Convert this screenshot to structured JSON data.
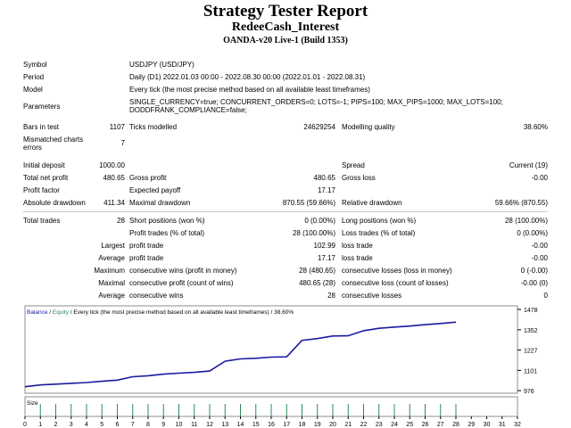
{
  "header": {
    "title": "Strategy Tester Report",
    "expert": "RedeeCash_Interest",
    "build": "OANDA-v20 Live-1 (Build 1353)"
  },
  "info": {
    "symbol_label": "Symbol",
    "symbol": "USDJPY (USD/JPY)",
    "period_label": "Period",
    "period": "Daily (D1) 2022.01.03 00:00 - 2022.08.30 00:00 (2022.01.01 - 2022.08.31)",
    "model_label": "Model",
    "model": "Every tick (the most precise method based on all available least timeframes)",
    "parameters_label": "Parameters",
    "parameters_1": "SINGLE_CURRENCY=true; CONCURRENT_ORDERS=0; LOTS=-1; PIPS=100; MAX_PIPS=1000; MAX_LOTS=100;",
    "parameters_2": "DODDFRANK_COMPLIANCE=false;"
  },
  "stats": {
    "bars_label": "Bars in test",
    "bars": "1107",
    "ticks_label": "Ticks modelled",
    "ticks": "24629254",
    "quality_label": "Modelling quality",
    "quality": "38.60%",
    "mismatched_label_1": "Mismatched charts",
    "mismatched_label_2": "errors",
    "mismatched": "7",
    "deposit_label": "Initial deposit",
    "deposit": "1000.00",
    "spread_label": "Spread",
    "spread": "Current (19)",
    "net_profit_label": "Total net profit",
    "net_profit": "480.65",
    "gross_profit_label": "Gross profit",
    "gross_profit": "480.65",
    "gross_loss_label": "Gross loss",
    "gross_loss": "-0.00",
    "profit_factor_label": "Profit factor",
    "payoff_label": "Expected payoff",
    "payoff": "17.17",
    "abs_dd_label": "Absolute drawdown",
    "abs_dd": "411.34",
    "max_dd_label": "Maximal drawdown",
    "max_dd": "870.55 (59.66%)",
    "rel_dd_label": "Relative drawdown",
    "rel_dd": "59.66% (870.55)",
    "total_trades_label": "Total trades",
    "total_trades": "28",
    "short_label": "Short positions (won %)",
    "short": "0 (0.00%)",
    "long_label": "Long positions (won %)",
    "long": "28 (100.00%)",
    "profit_trades_label": "Profit trades (% of total)",
    "profit_trades": "28 (100.00%)",
    "loss_trades_label": "Loss trades (% of total)",
    "loss_trades": "0 (0.00%)",
    "largest_label": "Largest",
    "largest_profit_label": "profit trade",
    "largest_profit": "102.99",
    "largest_loss_label": "loss trade",
    "largest_loss": "-0.00",
    "average_label": "Average",
    "avg_profit_label": "profit trade",
    "avg_profit": "17.17",
    "avg_loss_label": "loss trade",
    "avg_loss": "-0.00",
    "maximum_label": "Maximum",
    "max_wins_money_label": "consecutive wins (profit in money)",
    "max_wins_money": "28 (480.65)",
    "max_losses_money_label": "consecutive losses (loss in money)",
    "max_losses_money": "0 (-0.00)",
    "maximal_label": "Maximal",
    "maximal_profit_label": "consecutive profit (count of wins)",
    "maximal_profit": "480.65 (28)",
    "maximal_loss_label": "consecutive loss (count of losses)",
    "maximal_loss": "-0.00 (0)",
    "avg2_label": "Average",
    "avg_wins_label": "consecutive wins",
    "avg_wins": "28",
    "avg_losses_label": "consecutive losses",
    "avg_losses": "0"
  },
  "chart_data": {
    "type": "line",
    "legend": {
      "balance": "Balance",
      "sep": " / ",
      "equity": "Equity",
      "rest": " / Every tick (the most precise method based on all available least timeframes) / 38.60%"
    },
    "colors": {
      "balance": "#1a1a9e",
      "equity": "#2e8b57",
      "size": "#2e8b57",
      "grid": "#a0a0a0"
    },
    "y_ticks": [
      1478,
      1352,
      1227,
      1101,
      976
    ],
    "ylim": [
      960,
      1500
    ],
    "xlim": [
      0,
      32
    ],
    "x_ticks": [
      0,
      1,
      2,
      3,
      4,
      5,
      6,
      7,
      8,
      9,
      10,
      11,
      12,
      13,
      14,
      15,
      16,
      17,
      18,
      19,
      20,
      21,
      22,
      23,
      24,
      25,
      26,
      27,
      28,
      29,
      30,
      31,
      32
    ],
    "balance": {
      "x": [
        0,
        1,
        2,
        3,
        4,
        5,
        6,
        7,
        8,
        9,
        10,
        11,
        12,
        13,
        14,
        15,
        16,
        17,
        18,
        19,
        20,
        21,
        22,
        23,
        24,
        25,
        26,
        27,
        28
      ],
      "y": [
        1000,
        1011,
        1016,
        1021,
        1026,
        1034,
        1041,
        1062,
        1068,
        1078,
        1084,
        1089,
        1097,
        1158,
        1172,
        1176,
        1183,
        1185,
        1287,
        1298,
        1314,
        1315,
        1346,
        1361,
        1369,
        1375,
        1384,
        1391,
        1399
      ]
    },
    "size_label": "Size",
    "size_x": [
      1,
      2,
      3,
      4,
      5,
      6,
      7,
      8,
      9,
      10,
      11,
      12,
      13,
      14,
      15,
      16,
      17,
      18,
      19,
      20,
      21,
      22,
      23,
      24,
      25,
      26,
      27,
      28
    ]
  }
}
